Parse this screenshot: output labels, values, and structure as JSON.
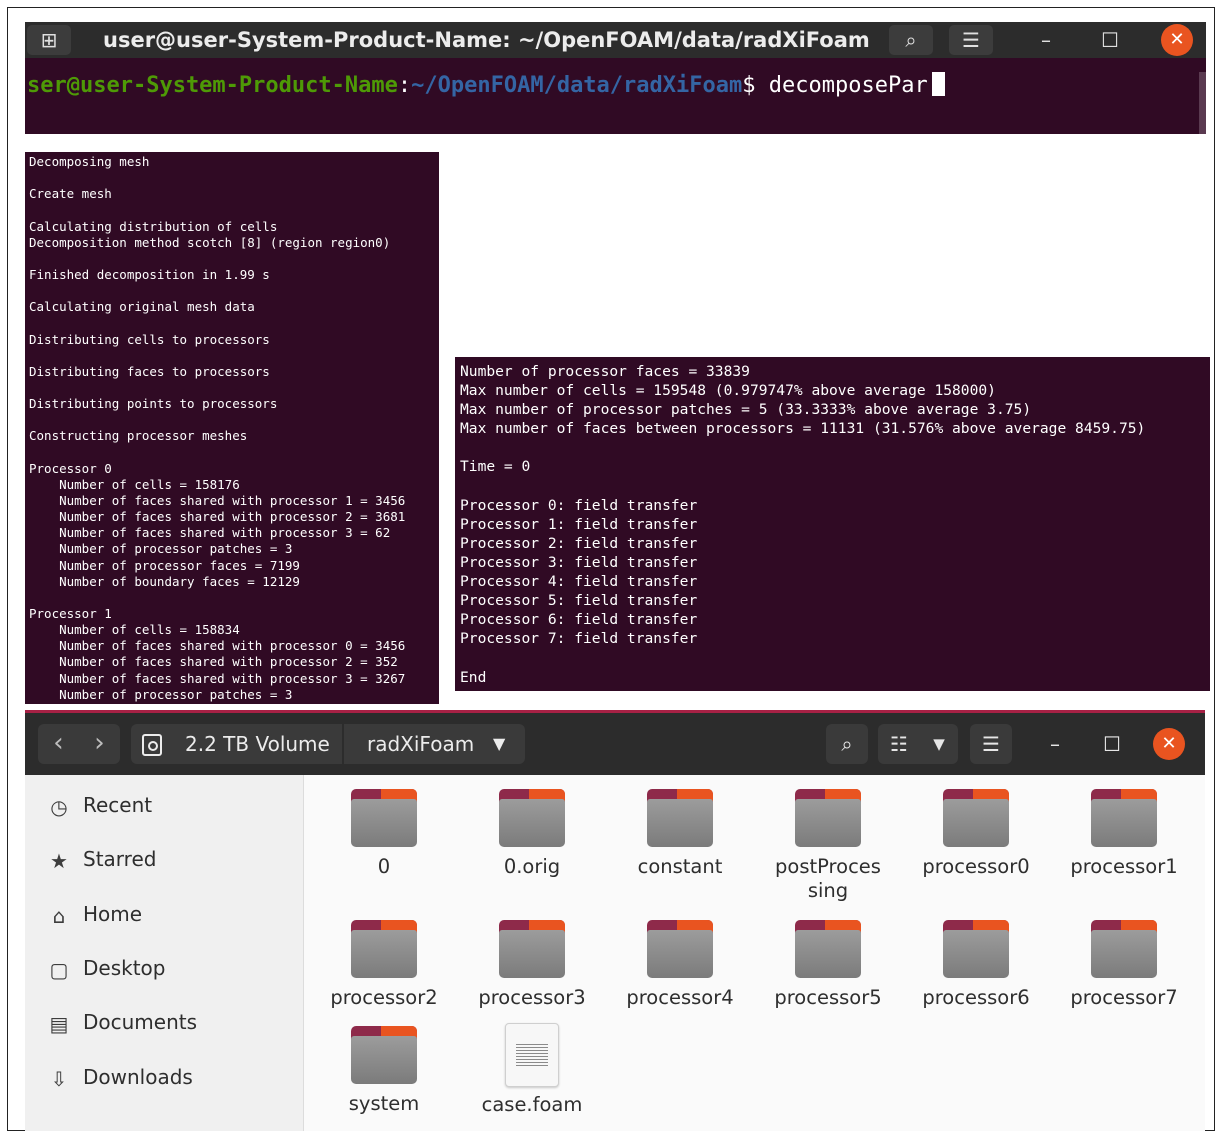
{
  "terminal": {
    "title": "user@user-System-Product-Name: ~/OpenFOAM/data/radXiFoam",
    "prompt_user": "ser@user-System-Product-Name",
    "prompt_colon": ":",
    "prompt_path": "~/OpenFOAM/data/radXiFoam",
    "prompt_dollar": "$ ",
    "command": "decomposePar"
  },
  "log_left": [
    "Decomposing mesh",
    "",
    "Create mesh",
    "",
    "Calculating distribution of cells",
    "Decomposition method scotch [8] (region region0)",
    "",
    "Finished decomposition in 1.99 s",
    "",
    "Calculating original mesh data",
    "",
    "Distributing cells to processors",
    "",
    "Distributing faces to processors",
    "",
    "Distributing points to processors",
    "",
    "Constructing processor meshes",
    "",
    "Processor 0",
    "    Number of cells = 158176",
    "    Number of faces shared with processor 1 = 3456",
    "    Number of faces shared with processor 2 = 3681",
    "    Number of faces shared with processor 3 = 62",
    "    Number of processor patches = 3",
    "    Number of processor faces = 7199",
    "    Number of boundary faces = 12129",
    "",
    "Processor 1",
    "    Number of cells = 158834",
    "    Number of faces shared with processor 0 = 3456",
    "    Number of faces shared with processor 2 = 352",
    "    Number of faces shared with processor 3 = 3267",
    "    Number of processor patches = 3"
  ],
  "log_right": [
    "Number of processor faces = 33839",
    "Max number of cells = 159548 (0.979747% above average 158000)",
    "Max number of processor patches = 5 (33.3333% above average 3.75)",
    "Max number of faces between processors = 11131 (31.576% above average 8459.75)",
    "",
    "Time = 0",
    "",
    "Processor 0: field transfer",
    "Processor 1: field transfer",
    "Processor 2: field transfer",
    "Processor 3: field transfer",
    "Processor 4: field transfer",
    "Processor 5: field transfer",
    "Processor 6: field transfer",
    "Processor 7: field transfer",
    "",
    "End"
  ],
  "file_manager": {
    "volume": "2.2 TB Volume",
    "current_folder": "radXiFoam",
    "sidebar": [
      {
        "label": "Recent",
        "icon": "clock-icon"
      },
      {
        "label": "Starred",
        "icon": "star-icon"
      },
      {
        "label": "Home",
        "icon": "home-icon"
      },
      {
        "label": "Desktop",
        "icon": "desktop-icon"
      },
      {
        "label": "Documents",
        "icon": "documents-icon"
      },
      {
        "label": "Downloads",
        "icon": "download-icon"
      }
    ],
    "files": [
      {
        "name": "0",
        "type": "folder"
      },
      {
        "name": "0.orig",
        "type": "folder"
      },
      {
        "name": "constant",
        "type": "folder"
      },
      {
        "name_line1": "postProces",
        "name_line2": "sing",
        "type": "folder"
      },
      {
        "name": "processor0",
        "type": "folder"
      },
      {
        "name": "processor1",
        "type": "folder"
      },
      {
        "name": "processor2",
        "type": "folder"
      },
      {
        "name": "processor3",
        "type": "folder"
      },
      {
        "name": "processor4",
        "type": "folder"
      },
      {
        "name": "processor5",
        "type": "folder"
      },
      {
        "name": "processor6",
        "type": "folder"
      },
      {
        "name": "processor7",
        "type": "folder"
      },
      {
        "name": "system",
        "type": "folder"
      },
      {
        "name": "case.foam",
        "type": "document"
      }
    ]
  },
  "colors": {
    "terminal_bg": "#300a24",
    "header_bg": "#2c2c2c",
    "accent": "#e95420",
    "prompt_user": "#4e9a06",
    "prompt_path": "#3465a4"
  }
}
